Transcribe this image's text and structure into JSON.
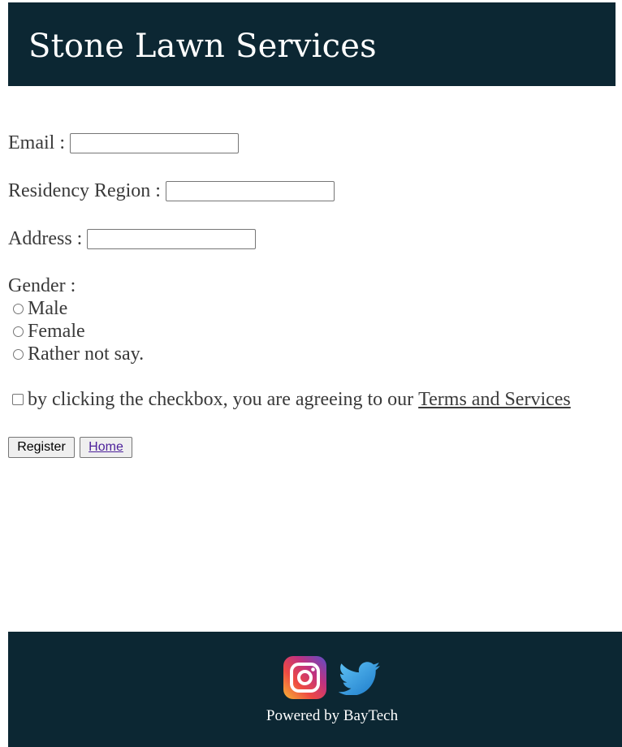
{
  "header": {
    "title": "Stone Lawn Services"
  },
  "form": {
    "email_label": "Email :",
    "email_value": "",
    "region_label": "Residency Region :",
    "region_value": "",
    "address_label": "Address :",
    "address_value": "",
    "gender_label": "Gender :",
    "gender_options": [
      {
        "label": "Male",
        "checked": false
      },
      {
        "label": "Female",
        "checked": false
      },
      {
        "label": "Rather not say.",
        "checked": false
      }
    ],
    "terms_text": "by clicking the checkbox, you are agreeing to our",
    "terms_link": "Terms and Services",
    "terms_checked": false,
    "register_label": "Register",
    "home_label": "Home"
  },
  "footer": {
    "powered_by": "Powered by BayTech",
    "icons": [
      "instagram-icon",
      "twitter-icon"
    ]
  },
  "colors": {
    "header_bg": "#0c2733",
    "footer_bg": "#0c2733",
    "text": "#3a3a3a",
    "link_visited": "#4b1f9a"
  }
}
